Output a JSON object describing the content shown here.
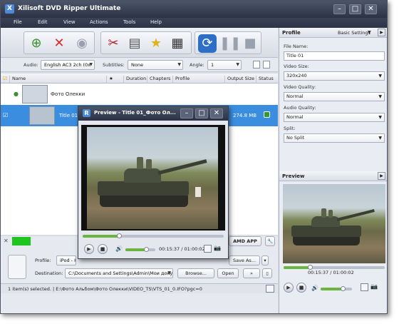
{
  "app": {
    "title": "Xilisoft DVD Ripper Ultimate",
    "icon": "app-logo-icon"
  },
  "window_controls": {
    "minimize": "–",
    "maximize": "□",
    "close": "✕"
  },
  "menu": [
    "File",
    "Edit",
    "View",
    "Actions",
    "Tools",
    "Help"
  ],
  "toolbar": {
    "buttons": [
      "add-dvd-icon",
      "remove-icon",
      "disc-icon",
      "cut-icon",
      "segment-icon",
      "effects-icon",
      "merge-icon",
      "convert-icon",
      "pause-icon",
      "stop-icon"
    ]
  },
  "options": {
    "audio_label": "Audio:",
    "audio_value": "English AC3 2ch (0x",
    "subtitles_label": "Subtitles:",
    "subtitles_value": "None",
    "angle_label": "Angle:",
    "angle_value": "1"
  },
  "columns": [
    "Name",
    "★",
    "Duration",
    "Chapters",
    "Profile",
    "Output Size",
    "Status"
  ],
  "rows": [
    {
      "name": "Фото Олекки",
      "selected": false
    },
    {
      "name": "Title 01",
      "output_size": "274.8 MB",
      "selected": true
    }
  ],
  "profile_panel": {
    "header": "Profile",
    "basic_settings": "Basic Settings",
    "file_name_label": "File Name:",
    "file_name_value": "Title 01",
    "video_size_label": "Video Size:",
    "video_size_value": "320x240",
    "video_quality_label": "Video Quality:",
    "video_quality_value": "Normal",
    "audio_quality_label": "Audio Quality:",
    "audio_quality_value": "Normal",
    "split_label": "Split:",
    "split_value": "No Split"
  },
  "preview_panel": {
    "header": "Preview",
    "time": "00:15:37 / 01:00:02",
    "progress": 0.26,
    "volume": 0.7
  },
  "preview_window": {
    "title": "Preview - Title 01_Фото Ол...",
    "time": "00:15:37 / 01:00:02",
    "progress": 0.26,
    "volume": 0.7
  },
  "bottom": {
    "amd_label": "AMD APP",
    "profile_label": "Profile:",
    "profile_value": "iPod - H...",
    "save_as": "Save As...",
    "destination_label": "Destination:",
    "destination_value": "C:\\Documents and Settings\\Admin\\Мои докум",
    "browse": "Browse...",
    "open": "Open"
  },
  "status": {
    "text": "1 item(s) selected. | E:\\Фото Альбом\\Фото Олекки\\VIDEO_TS\\VTS_01_0.IFO?pgc=0"
  }
}
